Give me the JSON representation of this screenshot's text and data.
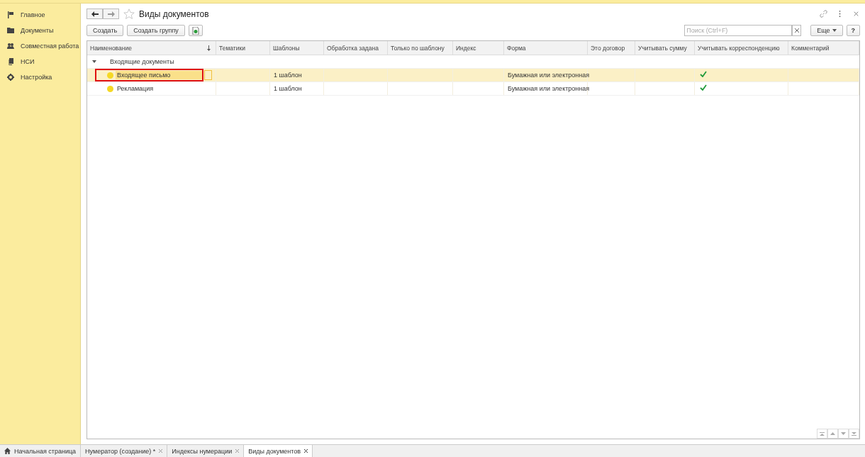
{
  "sidebar": {
    "items": [
      {
        "label": "Главное"
      },
      {
        "label": "Документы"
      },
      {
        "label": "Совместная работа"
      },
      {
        "label": "НСИ"
      },
      {
        "label": "Настройка"
      }
    ]
  },
  "header": {
    "title": "Виды документов",
    "favorite": false
  },
  "toolbar": {
    "buttons": [
      "Создать",
      "Создать группу"
    ],
    "search": {
      "placeholder": "Поиск (Ctrl+F)"
    },
    "more": "Еще",
    "help": "?"
  },
  "table": {
    "columns": [
      {
        "label": "Наименование",
        "sorted": true
      },
      {
        "label": "Тематики",
        "sorted": false
      },
      {
        "label": "Шаблоны",
        "sorted": false
      },
      {
        "label": "Обработка задана",
        "sorted": false
      },
      {
        "label": "Только по шаблону",
        "sorted": false
      },
      {
        "label": "Индекс",
        "sorted": false
      },
      {
        "label": "Форма",
        "sorted": false
      },
      {
        "label": "Это договор",
        "sorted": false
      },
      {
        "label": "Учитывать сумму",
        "sorted": false
      },
      {
        "label": "Учитывать корреспонденцию",
        "sorted": false
      },
      {
        "label": "Комментарий",
        "sorted": false
      }
    ],
    "groups": [
      {
        "name": "Входящие документы",
        "expanded": true,
        "rows": [
          {
            "name": "Входящее письмо",
            "templates": "1 шаблон",
            "form": "Бумажная или электронная",
            "correspondence": true,
            "selected": true,
            "color": "#f5d824"
          },
          {
            "name": "Рекламация",
            "templates": "1 шаблон",
            "form": "Бумажная или электронная",
            "correspondence": true,
            "selected": false,
            "color": "#f5d824"
          }
        ]
      }
    ]
  },
  "tabs": [
    {
      "label": "Начальная страница",
      "kind": "home",
      "selected": false
    },
    {
      "label": "Нумератор (создание) *",
      "kind": "page",
      "selected": false
    },
    {
      "label": "Индексы нумерации",
      "kind": "page",
      "selected": false
    },
    {
      "label": "Виды документов",
      "kind": "page",
      "selected": true
    }
  ]
}
